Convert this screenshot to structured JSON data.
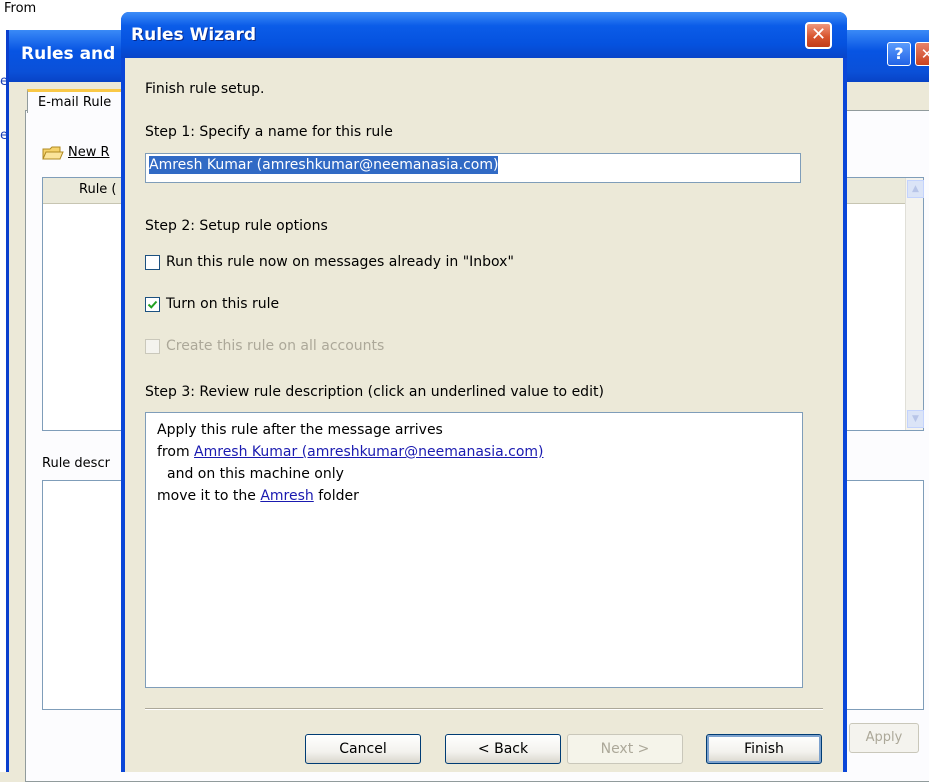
{
  "background": {
    "top_label": "From",
    "window_title": "Rules and",
    "help_glyph": "?",
    "tab_label": "E-mail Rule",
    "new_rule_label": "New R",
    "column_header": "Rule (",
    "rule_desc_label": "Rule descr",
    "apply_label": "Apply",
    "edge_e": "e",
    "edge_c": "c"
  },
  "wizard": {
    "title": "Rules Wizard",
    "close_glyph": "✕",
    "finish_setup": "Finish rule setup.",
    "step1_label": "Step 1: Specify a name for this rule",
    "rule_name": "Amresh Kumar (amreshkumar@neemanasia.com)",
    "step2_label": "Step 2: Setup rule options",
    "options": [
      {
        "label": "Run this rule now on messages already in \"Inbox\"",
        "checked": false,
        "enabled": true
      },
      {
        "label": "Turn on this rule",
        "checked": true,
        "enabled": true
      },
      {
        "label": "Create this rule on all accounts",
        "checked": false,
        "enabled": false
      }
    ],
    "step3_label": "Step 3: Review rule description (click an underlined value to edit)",
    "description": {
      "line1": "Apply this rule after the message arrives",
      "line2_prefix": "from ",
      "line2_link": "Amresh Kumar (amreshkumar@neemanasia.com)",
      "line3": "and on this machine only",
      "line4_prefix": "move it to the ",
      "line4_link": "Amresh",
      "line4_suffix": " folder"
    },
    "buttons": {
      "cancel": "Cancel",
      "back": "< Back",
      "next": "Next >",
      "finish": "Finish"
    }
  },
  "colors": {
    "titlebar_blue": "#0a50d8",
    "dialog_face": "#ece9d8",
    "selection": "#316ac5",
    "link": "#1a1ab0",
    "check_green": "#21a121"
  }
}
